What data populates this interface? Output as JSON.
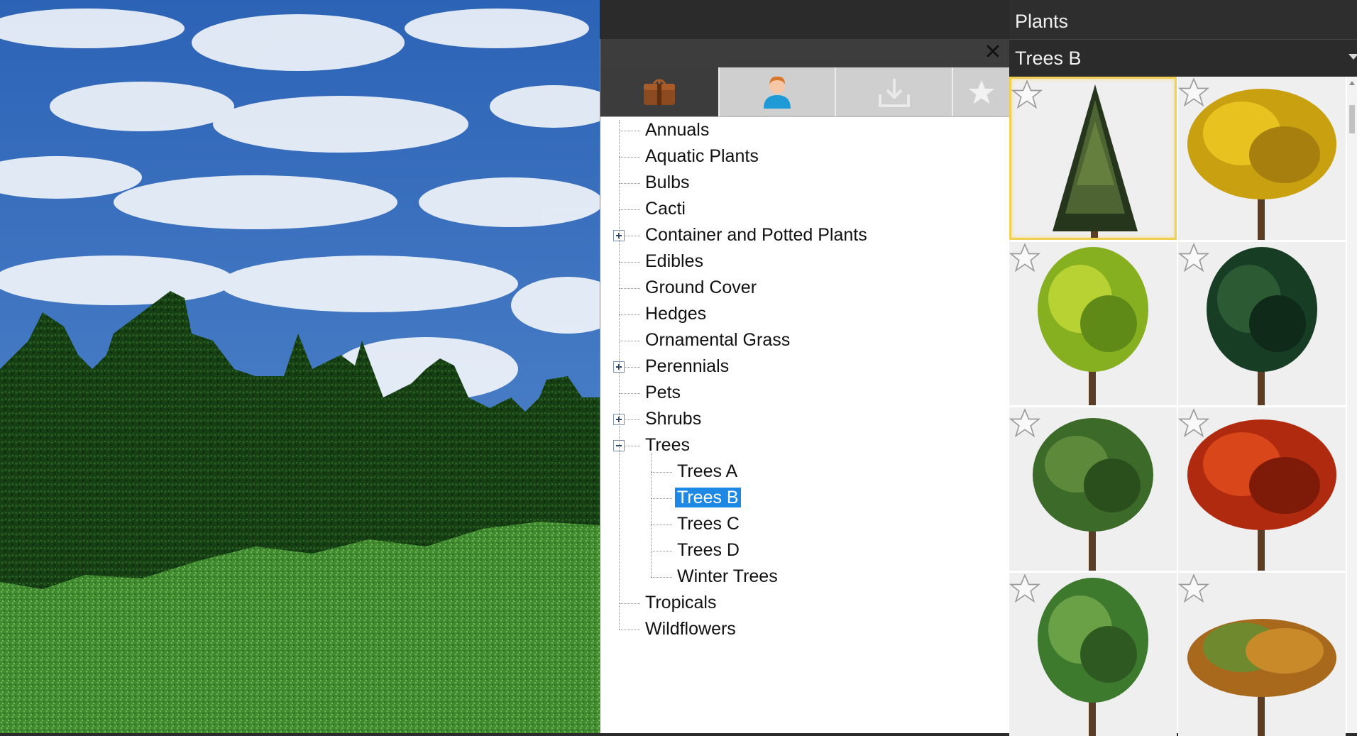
{
  "library": {
    "tabs": [
      {
        "name": "library-catalog-tab",
        "icon": "package-icon",
        "active": true
      },
      {
        "name": "user-catalog-tab",
        "icon": "user-icon",
        "active": false
      },
      {
        "name": "downloads-tab",
        "icon": "download-tray-icon",
        "active": false
      },
      {
        "name": "favorites-tab",
        "icon": "star-icon",
        "active": false
      }
    ],
    "tree": [
      {
        "label": "Annuals",
        "level": 0
      },
      {
        "label": "Aquatic Plants",
        "level": 0
      },
      {
        "label": "Bulbs",
        "level": 0
      },
      {
        "label": "Cacti",
        "level": 0
      },
      {
        "label": "Container and Potted Plants",
        "level": 0,
        "expander": "plus"
      },
      {
        "label": "Edibles",
        "level": 0
      },
      {
        "label": "Ground Cover",
        "level": 0
      },
      {
        "label": "Hedges",
        "level": 0
      },
      {
        "label": "Ornamental Grass",
        "level": 0
      },
      {
        "label": "Perennials",
        "level": 0,
        "expander": "plus"
      },
      {
        "label": "Pets",
        "level": 0
      },
      {
        "label": "Shrubs",
        "level": 0,
        "expander": "plus"
      },
      {
        "label": "Trees",
        "level": 0,
        "expander": "minus"
      },
      {
        "label": "Trees A",
        "level": 1
      },
      {
        "label": "Trees B",
        "level": 1,
        "selected": true
      },
      {
        "label": "Trees C",
        "level": 1
      },
      {
        "label": "Trees D",
        "level": 1
      },
      {
        "label": "Winter Trees",
        "level": 1
      },
      {
        "label": "Tropicals",
        "level": 0
      },
      {
        "label": "Wildflowers",
        "level": 0
      }
    ]
  },
  "catalog": {
    "title": "Plants",
    "folder": "Trees B",
    "thumbnails": [
      {
        "name": "conifer-tree-thumb",
        "kind": "conifer",
        "colors": [
          "#25361c",
          "#4e6432",
          "#6f8a43"
        ],
        "selected": true
      },
      {
        "name": "yellow-maple-thumb",
        "kind": "round",
        "colors": [
          "#c9a010",
          "#e8c21e",
          "#a77f0e"
        ]
      },
      {
        "name": "lime-tree-thumb",
        "kind": "oval",
        "colors": [
          "#86b020",
          "#b8d234",
          "#5f8a18"
        ]
      },
      {
        "name": "dark-oak-thumb",
        "kind": "oval",
        "colors": [
          "#173d25",
          "#2b5a33",
          "#0f2a18"
        ]
      },
      {
        "name": "green-tree-thumb",
        "kind": "open",
        "colors": [
          "#3c6a28",
          "#5c8a3a",
          "#2a4f1c"
        ]
      },
      {
        "name": "red-maple-thumb",
        "kind": "round",
        "colors": [
          "#b02a10",
          "#d8461a",
          "#7e1a08"
        ]
      },
      {
        "name": "young-tree-thumb",
        "kind": "oval",
        "colors": [
          "#3e7a2d",
          "#6aa046",
          "#2e5a22"
        ]
      },
      {
        "name": "autumn-spreading-thumb",
        "kind": "spreading",
        "colors": [
          "#a8691c",
          "#6f8a2e",
          "#c98a2a"
        ]
      }
    ]
  }
}
